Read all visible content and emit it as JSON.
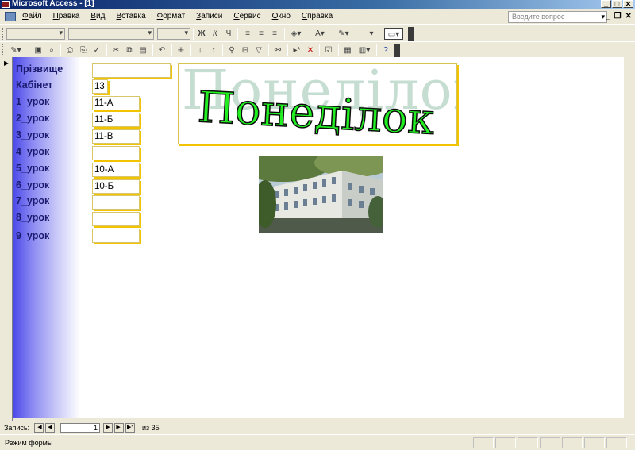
{
  "window": {
    "title": "Microsoft Access - [1]"
  },
  "menu": {
    "items": [
      "Файл",
      "Правка",
      "Вид",
      "Вставка",
      "Формат",
      "Записи",
      "Сервис",
      "Окно",
      "Справка"
    ],
    "question_placeholder": "Введите вопрос"
  },
  "form": {
    "title": "Понеділок",
    "fields": [
      {
        "label": "Прізвище",
        "value": ""
      },
      {
        "label": "Кабінет",
        "value": "13"
      },
      {
        "label": "1_урок",
        "value": "11-А"
      },
      {
        "label": "2_урок",
        "value": "11-Б"
      },
      {
        "label": "3_урок",
        "value": "11-В"
      },
      {
        "label": "4_урок",
        "value": ""
      },
      {
        "label": "5_урок",
        "value": "10-А"
      },
      {
        "label": "6_урок",
        "value": "10-Б"
      },
      {
        "label": "7_урок",
        "value": ""
      },
      {
        "label": "8_урок",
        "value": ""
      },
      {
        "label": "9_урок",
        "value": ""
      }
    ]
  },
  "navigation": {
    "label": "Запись:",
    "current_record": "1",
    "of_label": "из",
    "total_records": "35"
  },
  "status": {
    "mode": "Режим формы"
  },
  "colors": {
    "label_text": "#1a1a6e",
    "field_border": "#f2c400",
    "title_green": "#22ef22",
    "title_watermark": "#c6ddd2"
  }
}
